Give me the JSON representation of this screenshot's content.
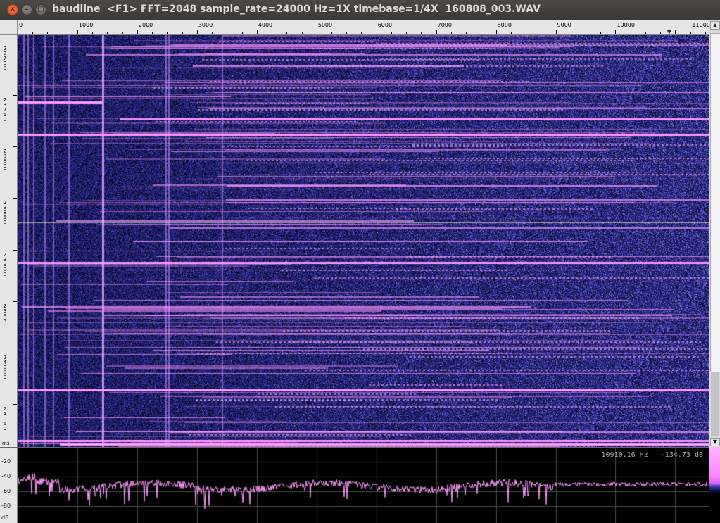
{
  "window": {
    "title": "baudline  <F1> FFT=2048 sample_rate=24000 Hz=1X timebase=1/4X  160808_003.WAV",
    "close_glyph": "×",
    "minimize_glyph": "–",
    "maximize_glyph": "□"
  },
  "freq_axis": {
    "labels": [
      "0",
      "1000",
      "2000",
      "3000",
      "4000",
      "5000",
      "6000",
      "7000",
      "8000",
      "9000",
      "10000",
      "11000 Hz"
    ],
    "max_hz": 11560,
    "marker_glyph": "▼",
    "marker_hz": 10910
  },
  "time_axis": {
    "labels": [
      "23700",
      "23750",
      "23800",
      "23850",
      "23900",
      "23950",
      "24000",
      "24050"
    ],
    "units": "ms"
  },
  "db_axis": {
    "labels": [
      "-20",
      "-40",
      "-60",
      "-80",
      "dB"
    ],
    "range": [
      -10,
      -100
    ]
  },
  "readout": {
    "frequency": "10910.16 Hz",
    "level": "-134.73 dB"
  },
  "scrollbar": {
    "up_glyph": "▲",
    "down_glyph": "▼"
  },
  "colors": {
    "background": "#000000",
    "spectrogram_low": "#0a0a30",
    "spectrogram_mid": "#3a3aa8",
    "spectrogram_high": "#ff99ff",
    "trace": "#ff99ff"
  }
}
